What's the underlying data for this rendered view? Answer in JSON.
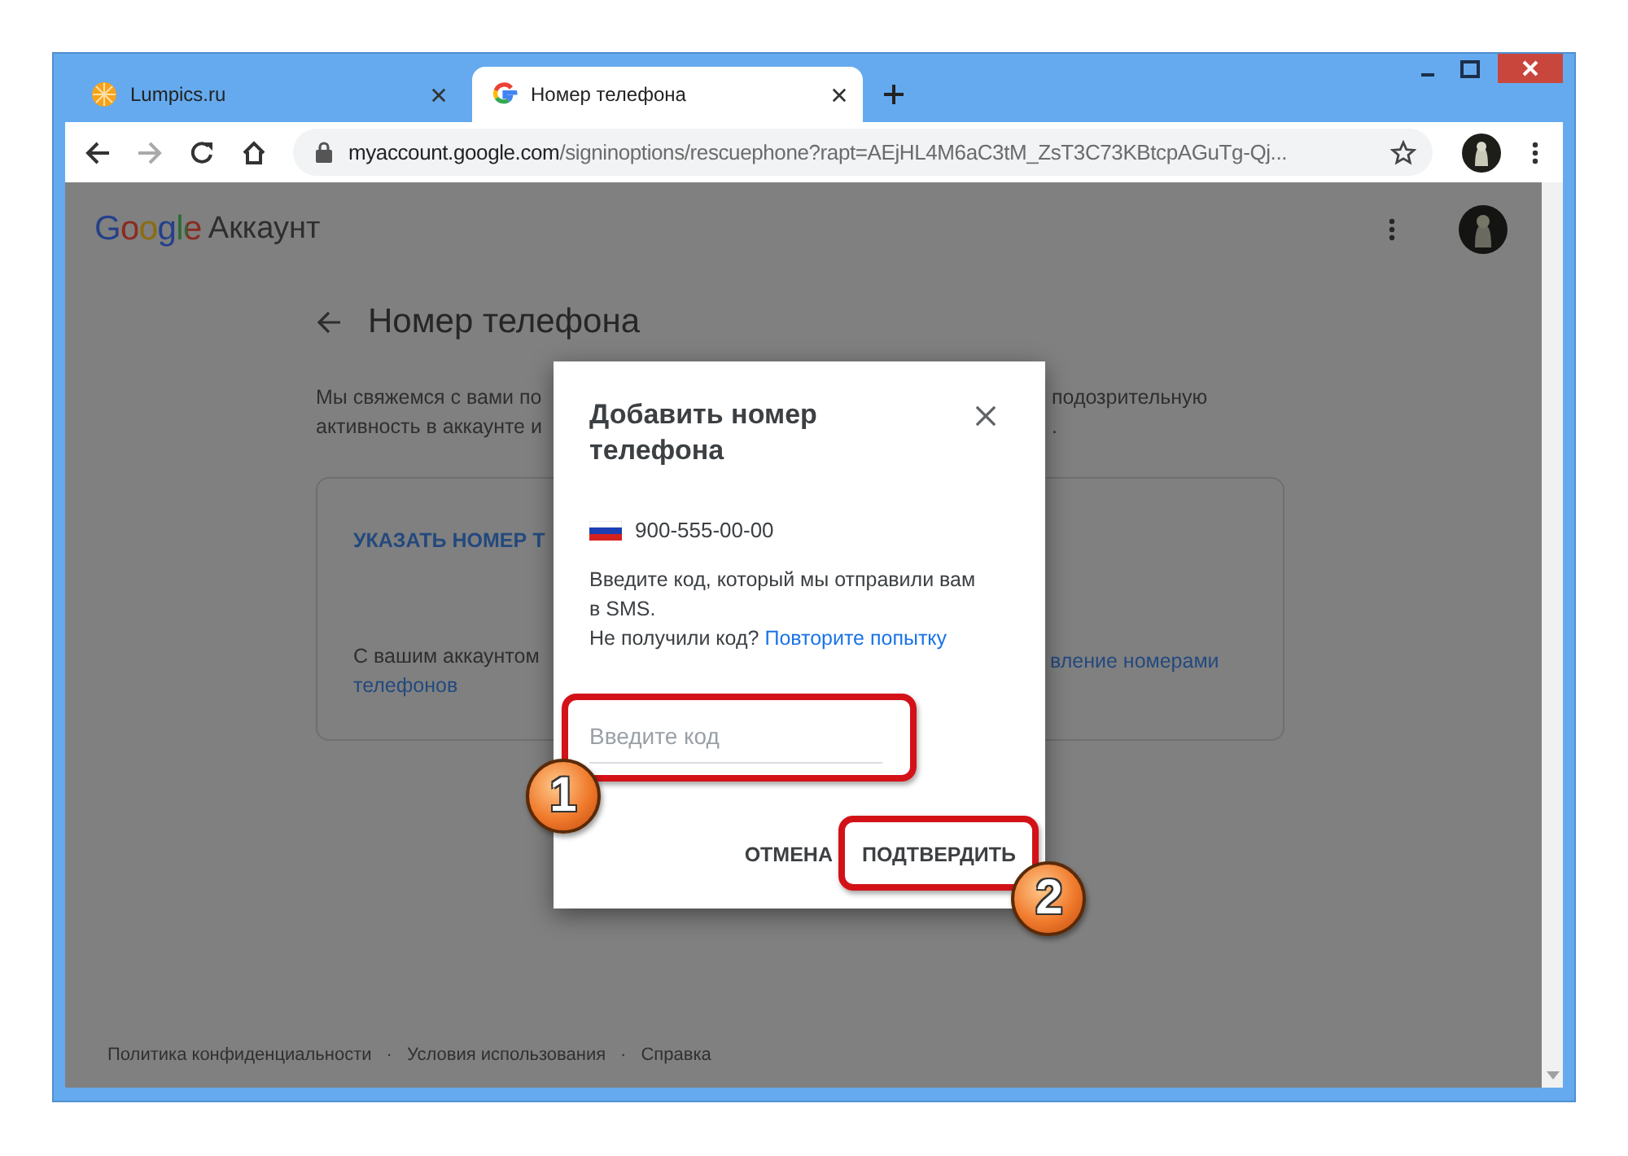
{
  "tabs": [
    {
      "label": "Lumpics.ru",
      "selected": false
    },
    {
      "label": "Номер телефона",
      "selected": true
    }
  ],
  "address_bar": {
    "host": "myaccount.google.com",
    "path": "/signinoptions/rescuephone?rapt=AEjHL4M6aC3tM_ZsT3C73KBtcpAGuTg-Qj..."
  },
  "header": {
    "brand": "Google",
    "product": "Аккаунт"
  },
  "page": {
    "title": "Номер телефона",
    "intro_left": [
      "Мы свяжемся с вами по",
      "активность в аккаунте и"
    ],
    "intro_right": [
      "подозрительную",
      "."
    ],
    "card": {
      "action": "УКАЗАТЬ НОМЕР Т",
      "text": "С вашим аккаунтом",
      "link_right": "вление номерами",
      "link_left": "телефонов"
    }
  },
  "dialog": {
    "title": "Добавить номер телефона",
    "phone": "900-555-00-00",
    "message": "Введите код, который мы отправили вам в SMS.",
    "retry_prompt": "Не получили код?",
    "retry_link": "Повторите попытку",
    "code_field": {
      "placeholder": "Введите код",
      "step": "1"
    },
    "buttons": [
      {
        "label": "ОТМЕНА"
      },
      {
        "label": "ПОДТВЕРДИТЬ",
        "step": "2"
      }
    ]
  },
  "footer": {
    "links": [
      "Политика конфиденциальности",
      "Условия использования",
      "Справка"
    ],
    "separators": [
      "·",
      "·"
    ]
  }
}
